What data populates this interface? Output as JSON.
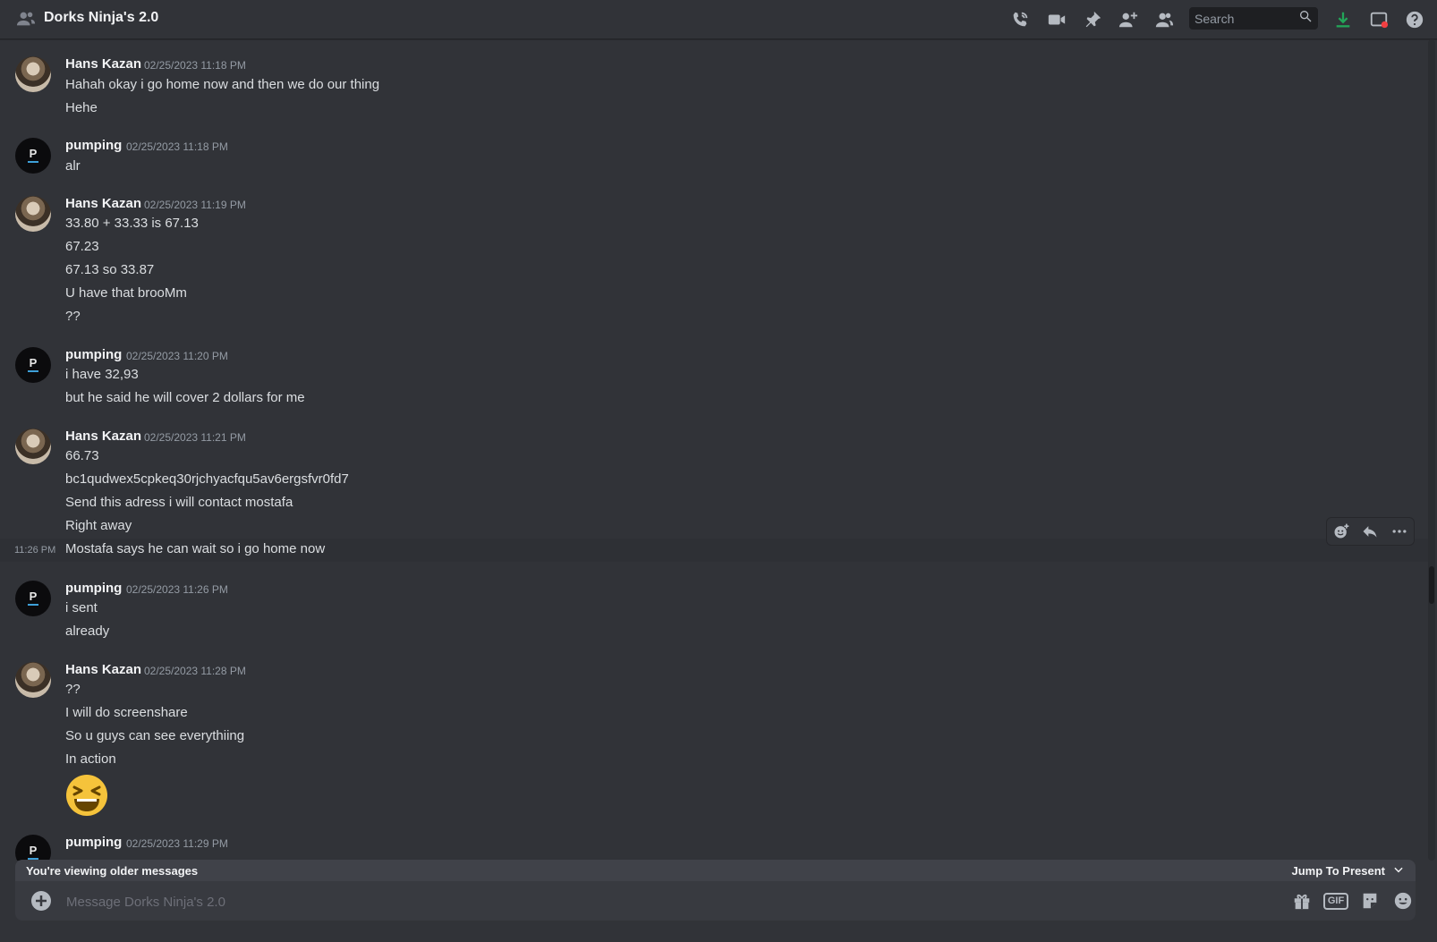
{
  "header": {
    "channel_title": "Dorks Ninja's 2.0",
    "search_placeholder": "Search",
    "icons": [
      "group-dm-icon",
      "phone-call-icon",
      "video-call-icon",
      "pin-icon",
      "add-friend-icon",
      "member-list-icon",
      "search-icon",
      "download-icon",
      "inbox-icon",
      "help-icon"
    ],
    "colors": {
      "download": "#23a559",
      "notification_dot": "#f23f42"
    }
  },
  "messages": [
    {
      "author": "Hans Kazan",
      "timestamp": "02/25/2023 11:18 PM",
      "lines": [
        "Hahah okay i go home now and then we do our thing",
        "Hehe"
      ]
    },
    {
      "author": "pumping",
      "timestamp": "02/25/2023 11:18 PM",
      "lines": [
        "alr"
      ]
    },
    {
      "author": "Hans Kazan",
      "timestamp": "02/25/2023 11:19 PM",
      "lines": [
        "33.80 + 33.33 is 67.13",
        "67.23",
        "67.13 so 33.87",
        "U have that brooMm",
        "??"
      ]
    },
    {
      "author": "pumping",
      "timestamp": "02/25/2023 11:20 PM",
      "lines": [
        "i have 32,93",
        "but he said  he will cover 2 dollars for me"
      ]
    },
    {
      "author": "Hans Kazan",
      "timestamp": "02/25/2023 11:21 PM",
      "lines": [
        "66.73",
        "bc1qudwex5cpkeq30rjchyacfqu5av6ergsfvr0fd7",
        "Send this adress i will contact mostafa",
        "Right away",
        "Mostafa says he can wait so i go home now"
      ],
      "hover_time": "11:26 PM"
    },
    {
      "author": "pumping",
      "timestamp": "02/25/2023 11:26 PM",
      "lines": [
        "i sent",
        "already"
      ]
    },
    {
      "author": "Hans Kazan",
      "timestamp": "02/25/2023 11:28 PM",
      "lines": [
        "??",
        "I will do screenshare",
        "So u guys can see everythiing",
        "In action"
      ],
      "emoji": "laughing-face-emoji"
    },
    {
      "author": "pumping",
      "timestamp": "02/25/2023 11:29 PM",
      "lines": []
    }
  ],
  "banner": {
    "older_text": "You're viewing older messages",
    "jump_label": "Jump To Present"
  },
  "composer": {
    "placeholder": "Message Dorks Ninja's 2.0",
    "gif_label": "GIF"
  }
}
